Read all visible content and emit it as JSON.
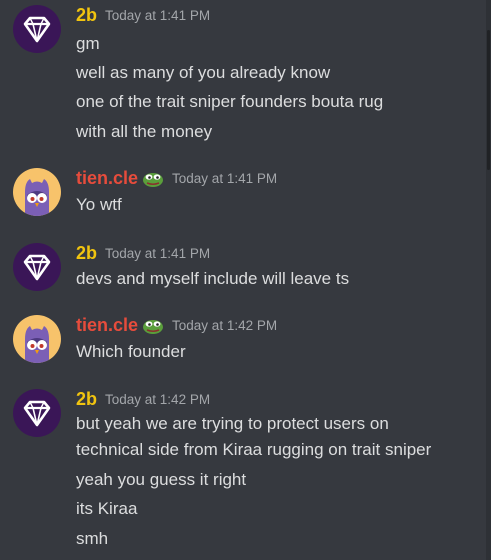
{
  "colors": {
    "background": "#36393f",
    "username_2b": "#f1c40f",
    "username_tien": "#e74c3c",
    "timestamp": "#a3a6aa",
    "message_text": "#dcddde"
  },
  "messages": [
    {
      "author": "2b",
      "avatar_icon": "diamond-avatar-icon",
      "timestamp": "Today at 1:41 PM",
      "lines": [
        "gm",
        "well as many of you already know",
        "one of the trait sniper founders bouta rug",
        "with all the money"
      ]
    },
    {
      "author": "tien.cle",
      "avatar_icon": "owl-avatar-icon",
      "badge_icon": "pepe-badge-icon",
      "timestamp": "Today at 1:41 PM",
      "lines": [
        "Yo wtf"
      ]
    },
    {
      "author": "2b",
      "avatar_icon": "diamond-avatar-icon",
      "timestamp": "Today at 1:41 PM",
      "lines": [
        "devs and myself include will leave ts"
      ]
    },
    {
      "author": "tien.cle",
      "avatar_icon": "owl-avatar-icon",
      "badge_icon": "pepe-badge-icon",
      "timestamp": "Today at 1:42 PM",
      "lines": [
        "Which founder"
      ]
    },
    {
      "author": "2b",
      "avatar_icon": "diamond-avatar-icon",
      "timestamp": "Today at 1:42 PM",
      "lines": [
        "but yeah we are trying to protect users on",
        "technical side from Kiraa rugging on trait sniper",
        "yeah you guess it right",
        "its Kiraa",
        "smh"
      ]
    }
  ]
}
